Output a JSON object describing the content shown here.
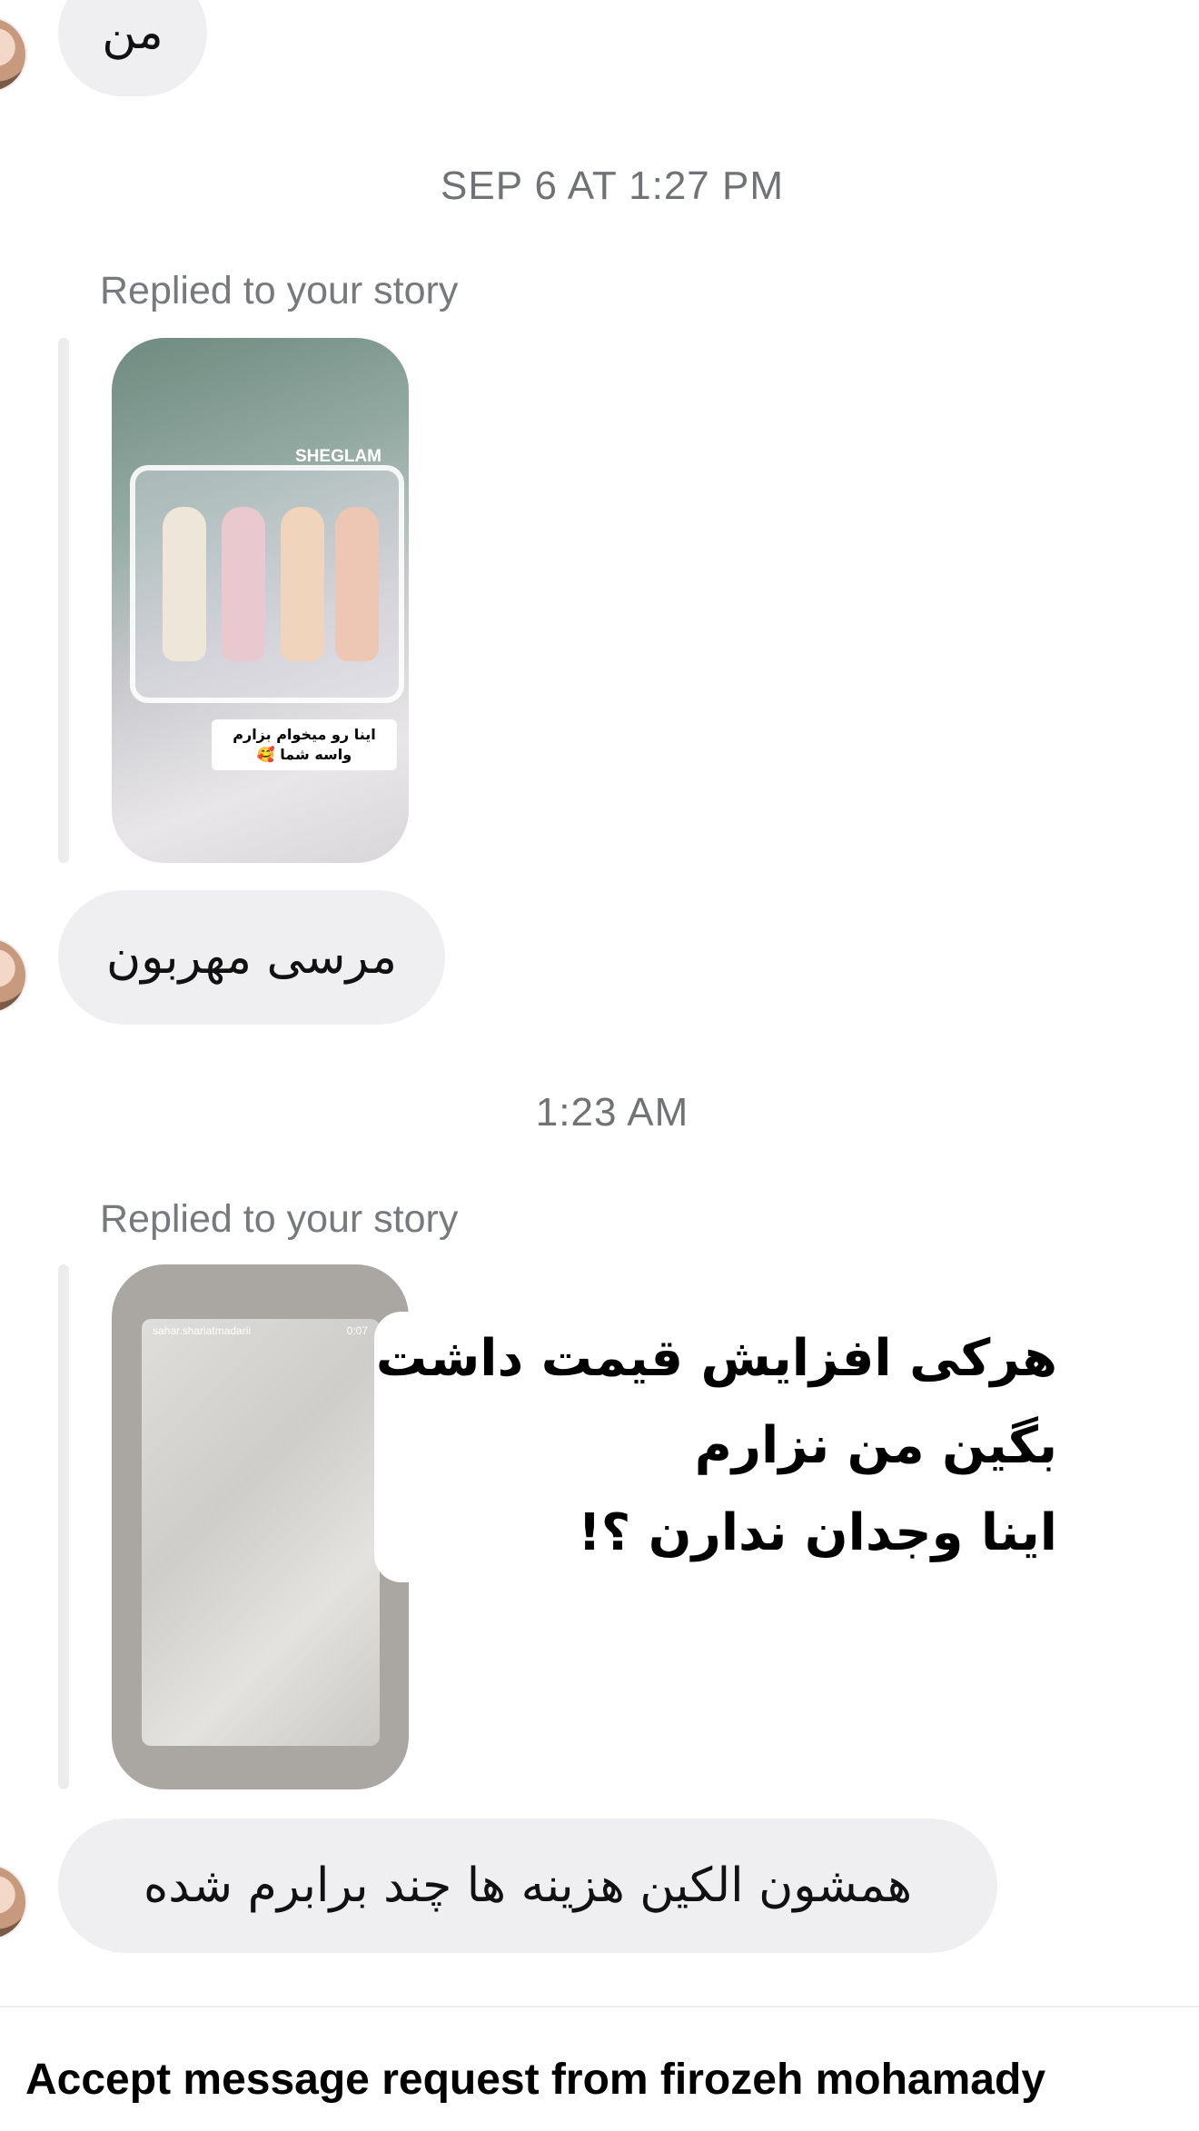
{
  "messages": {
    "msg1": "من",
    "timestamp1": "SEP 6 AT 1:27 PM",
    "reply1_label": "Replied to your story",
    "story1": {
      "brand": "SHEGLAM",
      "caption": "اینا رو میخوام بزارم واسه شما 🥰"
    },
    "msg2": "مرسی مهربون",
    "timestamp2": "1:23 AM",
    "reply2_label": "Replied to your story",
    "story2": {
      "username": "sahar.shariatmadarii",
      "time": "0:07",
      "overlay_line1": "هرکی افزایش قیمت داشت",
      "overlay_line2": "بگین من نزارم",
      "overlay_line3": "اینا وجدان ندارن ؟!"
    },
    "msg3": "همشون الکین هزینه ها چند برابرم شده"
  },
  "footer": {
    "accept_prompt": "Accept message request from firozeh mohamady"
  }
}
